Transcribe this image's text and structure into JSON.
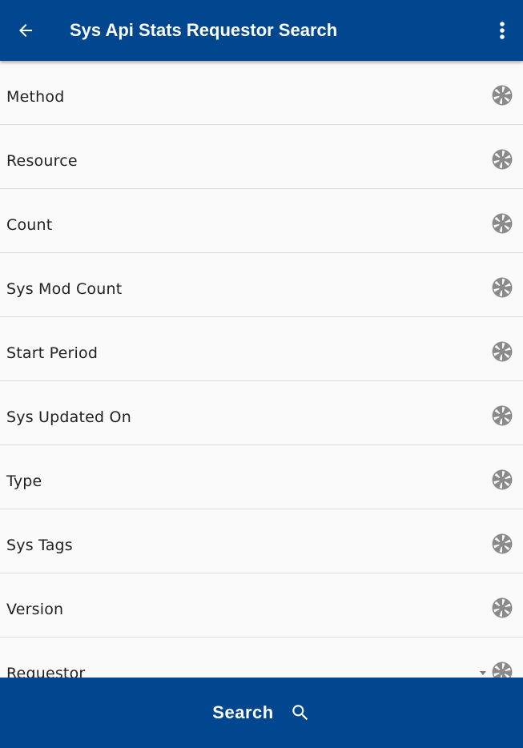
{
  "appbar": {
    "title": "Sys Api Stats Requestor Search",
    "back_icon": "arrow-left-icon",
    "menu_icon": "more-vertical-icon",
    "background": "#01478f"
  },
  "fields": [
    {
      "label": "Method",
      "icon": "aperture-icon"
    },
    {
      "label": "Resource",
      "icon": "aperture-icon"
    },
    {
      "label": "Count",
      "icon": "aperture-icon"
    },
    {
      "label": "Sys Mod Count",
      "icon": "aperture-icon"
    },
    {
      "label": "Start Period",
      "icon": "aperture-icon"
    },
    {
      "label": "Sys Updated On",
      "icon": "aperture-icon"
    },
    {
      "label": "Type",
      "icon": "aperture-icon"
    },
    {
      "label": "Sys Tags",
      "icon": "aperture-icon"
    },
    {
      "label": "Version",
      "icon": "aperture-icon"
    },
    {
      "label": "Requestor",
      "icon": "aperture-icon",
      "has_dropdown": true
    }
  ],
  "bottom_bar": {
    "search_label": "Search",
    "search_icon": "search-icon",
    "background": "#01478f"
  },
  "colors": {
    "accent": "#01478f",
    "icon_gray": "#8a8a8a",
    "text": "#222222",
    "divider": "#dddddd"
  }
}
